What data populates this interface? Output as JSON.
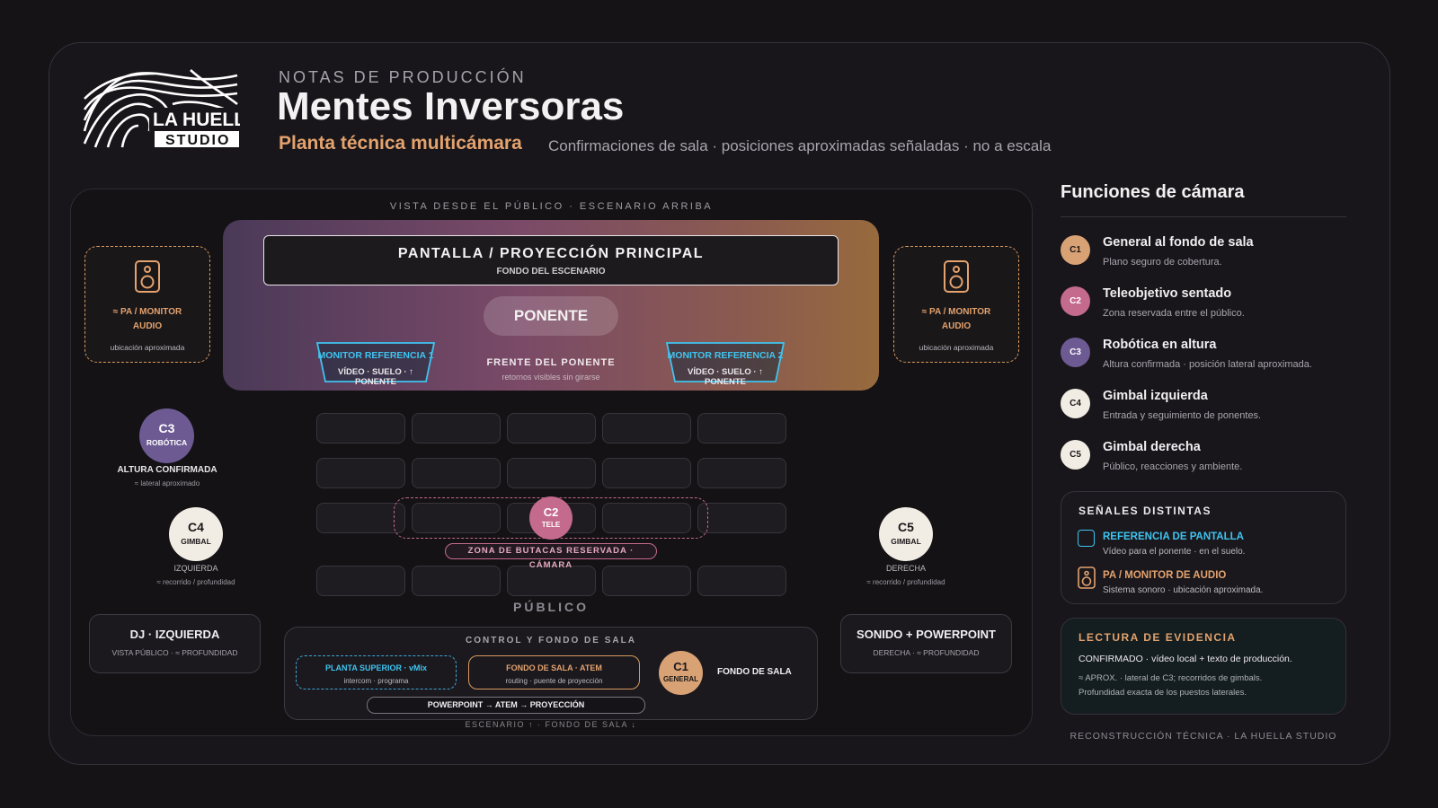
{
  "header": {
    "kicker": "NOTAS DE PRODUCCIÓN",
    "title": "Mentes Inversoras",
    "subtitle": "Planta técnica multicámara",
    "subtitle_note": "Confirmaciones de sala · posiciones aproximadas señaladas · no a escala",
    "logo_text_1": "LA HUELLA",
    "logo_text_2": "STUDIO"
  },
  "plan": {
    "view_label": "VISTA DESDE EL PÚBLICO · ESCENARIO ARRIBA",
    "screen_title": "PANTALLA / PROYECCIÓN PRINCIPAL",
    "screen_sub": "FONDO DEL ESCENARIO",
    "ponente": "PONENTE",
    "monitor_1": {
      "title": "MONITOR REFERENCIA 1",
      "sub": "VÍDEO · SUELO · ↑ PONENTE"
    },
    "monitor_2": {
      "title": "MONITOR REFERENCIA 2",
      "sub": "VÍDEO · SUELO · ↑ PONENTE"
    },
    "frente_title": "FRENTE DEL PONENTE",
    "frente_sub": "retornos visibles sin girarse",
    "pa_left": {
      "l1": "≈ PA / MONITOR",
      "l2": "AUDIO",
      "note": "ubicación aproximada"
    },
    "pa_right": {
      "l1": "≈ PA / MONITOR",
      "l2": "AUDIO",
      "note": "ubicación aproximada"
    },
    "reserved_label": "ZONA DE BUTACAS RESERVADA · CÁMARA",
    "audience_label": "PÚBLICO",
    "cameras": {
      "c3": {
        "id": "C3",
        "role": "ROBÓTICA",
        "label": "ALTURA CONFIRMADA",
        "sub": "≈ lateral aproximado"
      },
      "c4": {
        "id": "C4",
        "role": "GIMBAL",
        "label": "IZQUIERDA",
        "sub": "≈ recorrido / profundidad"
      },
      "c2": {
        "id": "C2",
        "role": "TELE"
      },
      "c5": {
        "id": "C5",
        "role": "GIMBAL",
        "label": "DERECHA",
        "sub": "≈ recorrido / profundidad"
      },
      "c1": {
        "id": "C1",
        "role": "GENERAL",
        "label": "FONDO DE SALA"
      }
    },
    "dj": {
      "title": "DJ · IZQUIERDA",
      "sub": "VISTA PÚBLICO · ≈ PROFUNDIDAD"
    },
    "sound": {
      "title": "SONIDO + POWERPOINT",
      "sub": "DERECHA · ≈ PROFUNDIDAD"
    },
    "control_title": "CONTROL Y FONDO DE SALA",
    "vmix": {
      "title": "PLANTA SUPERIOR · vMix",
      "sub": "intercom · programa"
    },
    "atem": {
      "title": "FONDO DE SALA · ATEM",
      "sub": "routing · puente de proyección"
    },
    "pipeline": "POWERPOINT → ATEM → PROYECCIÓN",
    "bottom_label": "ESCENARIO ↑ · FONDO DE SALA ↓"
  },
  "functions": {
    "title": "Funciones de cámara",
    "items": [
      {
        "id": "C1",
        "title": "General al fondo de sala",
        "desc": "Plano seguro de cobertura."
      },
      {
        "id": "C2",
        "title": "Teleobjetivo sentado",
        "desc": "Zona reservada entre el público."
      },
      {
        "id": "C3",
        "title": "Robótica en altura",
        "desc": "Altura confirmada · posición lateral aproximada."
      },
      {
        "id": "C4",
        "title": "Gimbal izquierda",
        "desc": "Entrada y seguimiento de ponentes."
      },
      {
        "id": "C5",
        "title": "Gimbal derecha",
        "desc": "Público, reacciones y ambiente."
      }
    ]
  },
  "signals": {
    "title": "SEÑALES DISTINTAS",
    "screen_ref": {
      "title": "REFERENCIA DE PANTALLA",
      "desc": "Vídeo para el ponente · en el suelo."
    },
    "pa_audio": {
      "title": "PA / MONITOR DE AUDIO",
      "desc": "Sistema sonoro · ubicación aproximada."
    }
  },
  "evidence": {
    "title": "LECTURA DE EVIDENCIA",
    "line1": "CONFIRMADO · vídeo local + texto de producción.",
    "line2": "≈ APROX. · lateral de C3; recorridos de gimbals.",
    "line3": "Profundidad exacta de los puestos laterales."
  },
  "footer": "RECONSTRUCCIÓN TÉCNICA · LA HUELLA STUDIO",
  "colors": {
    "accent_orange": "#e3a26e",
    "cyan": "#3fc4ef",
    "c1": "#d9a274",
    "c2": "#c46a8d",
    "c3": "#6d5a93",
    "c4": "#f2ede4",
    "c5": "#f2ede4"
  }
}
